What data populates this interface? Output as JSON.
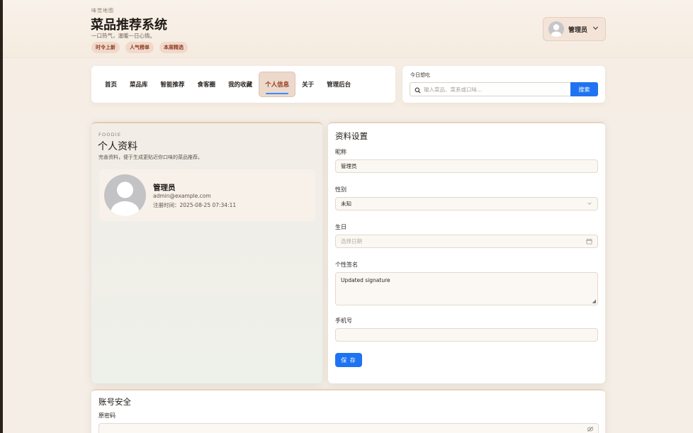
{
  "header": {
    "kicker": "味觉地图",
    "title": "菜品推荐系统",
    "subtitle": "一口热气，温暖一日心情。",
    "tags": [
      "时令上新",
      "人气榜单",
      "本周精选"
    ]
  },
  "user_menu": {
    "name": "管理员",
    "icon": "user-avatar-icon"
  },
  "nav": {
    "items": [
      "首页",
      "菜品库",
      "智能推荐",
      "食客圈",
      "我的收藏",
      "个人信息",
      "关于",
      "管理后台"
    ],
    "active": "个人信息"
  },
  "search": {
    "label": "今日想吃",
    "placeholder": "输入菜品、菜系或口味...",
    "button": "搜索"
  },
  "profile": {
    "kicker": "FOODIE",
    "title": "个人资料",
    "subtitle": "完善资料，便于生成更贴近你口味的菜品推荐。",
    "name": "管理员",
    "email": "admin@example.com",
    "registered": "注册时间：2025-08-25 07:34:11"
  },
  "settings": {
    "title": "资料设置",
    "nickname_label": "昵称",
    "nickname_value": "管理员",
    "gender_label": "性别",
    "gender_value": "未知",
    "birthday_label": "生日",
    "birthday_placeholder": "选择日期",
    "signature_label": "个性签名",
    "signature_value": "Updated signature",
    "phone_label": "手机号",
    "phone_value": "",
    "save_label": "保 存"
  },
  "security": {
    "title": "账号安全",
    "old_password_label": "原密码"
  },
  "colors": {
    "accent": "#1f73f2",
    "active_nav_bg": "#ecd9cc",
    "active_nav_text": "#9a3a1a",
    "tag_bg": "#f1d8cb"
  }
}
